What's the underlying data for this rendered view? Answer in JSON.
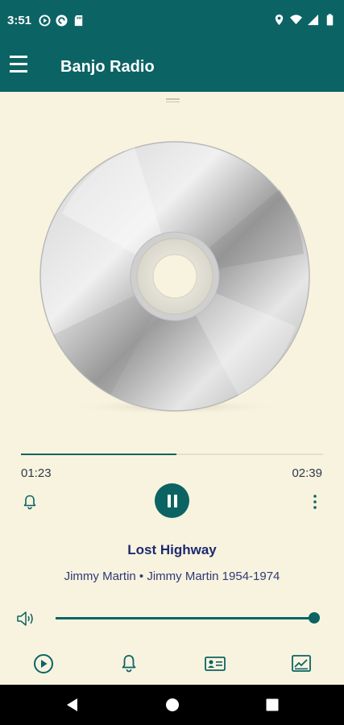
{
  "status_bar": {
    "time": "3:51",
    "icons_left": [
      "play-circle-icon",
      "pocket-casts-icon",
      "sd-card-icon"
    ],
    "icons_right": [
      "location-icon",
      "wifi-icon",
      "signal-icon",
      "battery-icon"
    ]
  },
  "app_bar": {
    "title": "Banjo Radio",
    "menu_icon": "hamburger-menu-icon"
  },
  "player": {
    "artwork": "cd-disc-icon",
    "elapsed": "01:23",
    "total": "02:39",
    "progress_fraction": 0.515,
    "state": "playing",
    "song_title": "Lost Highway",
    "song_subtitle": "Jimmy Martin • Jimmy Martin 1954-1974",
    "volume_fraction": 1.0
  },
  "controls": {
    "left_icon": "alarm-bell-icon",
    "center_icon": "pause-icon",
    "right_icon": "more-vertical-icon",
    "volume_icon": "speaker-icon"
  },
  "tabs": [
    {
      "name": "play-circle-tab-icon"
    },
    {
      "name": "bell-tab-icon"
    },
    {
      "name": "id-card-tab-icon"
    },
    {
      "name": "chart-tab-icon"
    }
  ],
  "nav_bar": [
    "back-icon",
    "home-icon",
    "recents-icon"
  ],
  "colors": {
    "primary": "#0c6364",
    "background": "#f8f3df",
    "title_text": "#1e2a6e"
  }
}
